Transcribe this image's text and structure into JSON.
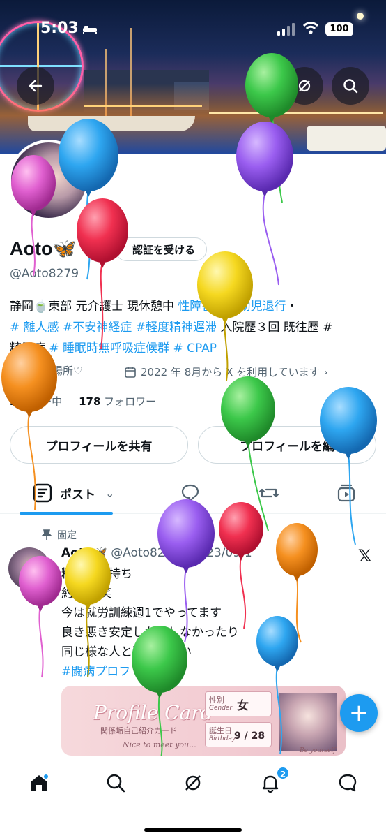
{
  "status_bar": {
    "time": "5:03",
    "battery": "100"
  },
  "profile": {
    "name": "Aoto🦋",
    "handle": "@Aoto8279",
    "verify_button": "認証を受ける",
    "bio_line1_prefix": "静岡🍵東部 元介護士 現休憩中",
    "bio_line1_tag_a": "性障害",
    "bio_line1_sep": " / ",
    "bio_line1_tag_b": "# 幼児退行",
    "bio_line1_suffix": "・",
    "bio_line2_tags": "# 離人感 #不安神経症 #軽度精神遅滞",
    "bio_line2_suffix": " 入院歴３回 既往歴 #",
    "bio_line3_prefix": "糖尿病",
    "bio_line3_tags": " # 睡眠時無呼吸症候群 # CPAP",
    "location": "る場所♡",
    "joined": "2022 年 8月から X を利用しています",
    "following_count": "2",
    "following_label": "ォロー中",
    "followers_count": "178",
    "followers_label": "フォロワー"
  },
  "buttons": {
    "share_profile": "プロフィールを共有",
    "edit_profile": "プロフィールを編"
  },
  "tabs": {
    "posts": "ポスト"
  },
  "post": {
    "pinned_label": "固定",
    "author": "Aoto🦋",
    "meta": "@Aoto8279 · 2023/09/1",
    "line1": "精神疾患持ち",
    "line2": "約 0 年笑",
    "line3": "今は就労訓練週1でやってます",
    "line4": "良き悪き安定したりしなかったり",
    "line5": "同じ様な人と繋がりたい",
    "tag": "#闘病プロフ",
    "card": {
      "title": "Profile Card",
      "subtitle": "関係垢自己紹介カード",
      "nice": "Nice to meet you...",
      "gender_label": "性別",
      "gender_sub": "Gender",
      "gender_value": "女",
      "birthday_label": "誕生日",
      "birthday_sub": "Birthday",
      "birthday_value": "9 / 28",
      "yourself": "Be yourself"
    }
  },
  "nav": {
    "notifications_badge": "2"
  },
  "colors": {
    "accent": "#1d9bf0",
    "text": "#0f1419",
    "muted": "#536471"
  }
}
